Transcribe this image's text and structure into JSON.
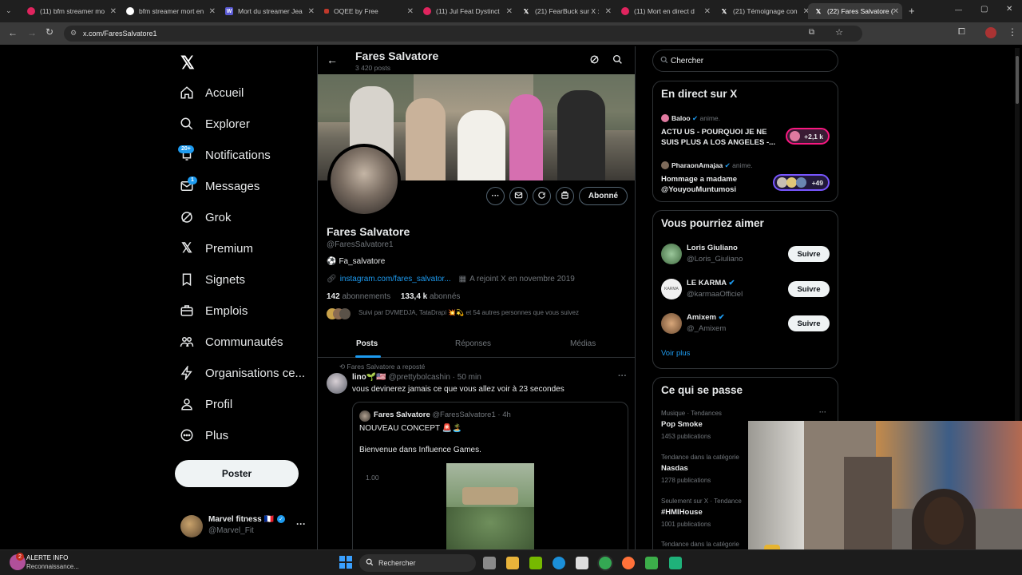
{
  "browser": {
    "tabs": [
      {
        "label": "(11) bfm streamer mo",
        "favicon": "youtube"
      },
      {
        "label": "bfm streamer mort en",
        "favicon": "google"
      },
      {
        "label": "Mort du streamer Jea",
        "favicon": "w"
      },
      {
        "label": "OQEE by Free",
        "favicon": "oqee"
      },
      {
        "label": "(11) Jul Feat Dystinct",
        "favicon": "youtube"
      },
      {
        "label": "(21) FearBuck sur X :",
        "favicon": "x"
      },
      {
        "label": "(11) Mort en direct d",
        "favicon": "youtube"
      },
      {
        "label": "(21) Témoignage con",
        "favicon": "x"
      },
      {
        "label": "(22) Fares Salvatore (",
        "favicon": "x"
      }
    ],
    "url": "x.com/FaresSalvatore1"
  },
  "nav": {
    "items": [
      {
        "label": "Accueil",
        "icon": "home-icon"
      },
      {
        "label": "Explorer",
        "icon": "search-icon"
      },
      {
        "label": "Notifications",
        "icon": "bell-icon",
        "badge": "20+"
      },
      {
        "label": "Messages",
        "icon": "mail-icon",
        "badge": "1"
      },
      {
        "label": "Grok",
        "icon": "grok-icon"
      },
      {
        "label": "Premium",
        "icon": "x-logo-icon"
      },
      {
        "label": "Signets",
        "icon": "bookmark-icon"
      },
      {
        "label": "Emplois",
        "icon": "briefcase-icon"
      },
      {
        "label": "Communautés",
        "icon": "people-icon"
      },
      {
        "label": "Organisations ce...",
        "icon": "lightning-icon"
      },
      {
        "label": "Profil",
        "icon": "person-icon"
      },
      {
        "label": "Plus",
        "icon": "more-circle-icon"
      }
    ],
    "post_button": "Poster",
    "account": {
      "name": "Marvel fitness 🇫🇷",
      "handle": "@Marvel_Fit"
    }
  },
  "profile": {
    "header_name": "Fares Salvatore",
    "header_posts": "3 420 posts",
    "name": "Fares Salvatore",
    "handle": "@FaresSalvatore1",
    "bio": "Fa_salvatore",
    "link": "instagram.com/fares_salvator...",
    "joined": "A rejoint X en novembre 2019",
    "following_count": "142",
    "following_label": "abonnements",
    "followers_count": "133,4 k",
    "followers_label": "abonnés",
    "followed_by": "Suivi par DVMEDJA, TataDrapi",
    "followed_by_more": "et 54 autres personnes que vous suivez",
    "follow_button": "Abonné",
    "tabs": [
      "Posts",
      "Réponses",
      "Médias"
    ]
  },
  "feed": {
    "repost_label": "Fares Salvatore a reposté",
    "post": {
      "author": "lino",
      "author_emoji": "🌱🇺🇸",
      "handle": "@prettybolcashin",
      "time": "· 50 min",
      "text": "vous devinerez jamais ce que vous allez voir à 23 secondes"
    },
    "quote": {
      "author": "Fares Salvatore",
      "handle": "@FaresSalvatore1",
      "time": "· 4h",
      "line1": "NOUVEAU CONCEPT 🚨🏝️",
      "line2": "Bienvenue dans Influence Games.",
      "media_label": "1.00"
    }
  },
  "right": {
    "search_placeholder": "Chercher",
    "live": {
      "title": "En direct sur X",
      "items": [
        {
          "host": "Baloo",
          "action": "anime.",
          "text": "ACTU US - POURQUOI JE NE SUIS PLUS A LOS ANGELES -...",
          "count": "+2,1 k"
        },
        {
          "host": "PharaonAmajaa",
          "action": "anime.",
          "text": "Hommage a madame @YouyouMuntumosi",
          "count": "+49"
        }
      ]
    },
    "suggest": {
      "title": "Vous pourriez aimer",
      "items": [
        {
          "name": "Loris Giuliano",
          "handle": "@Loris_Giuliano",
          "verified": false,
          "button": "Suivre"
        },
        {
          "name": "LE KARMA",
          "handle": "@karmaaOfficiel",
          "verified": true,
          "button": "Suivre"
        },
        {
          "name": "Amixem",
          "handle": "@_Amixem",
          "verified": true,
          "button": "Suivre"
        }
      ],
      "more": "Voir plus"
    },
    "trends": {
      "title": "Ce qui se passe",
      "items": [
        {
          "context": "Musique · Tendances",
          "name": "Pop Smoke",
          "count": "1453 publications"
        },
        {
          "context": "Tendance dans la catégorie",
          "name": "Nasdas",
          "count": "1278 publications"
        },
        {
          "context": "Seulement sur X · Tendance",
          "name": "#HMIHouse",
          "count": "1001 publications"
        },
        {
          "context": "Tendance dans la catégorie",
          "name": "",
          "count": ""
        }
      ]
    }
  },
  "taskbar": {
    "alert_title": "ALERTE INFO",
    "alert_sub": "Reconnaissance...",
    "alert_badge": "2",
    "search_label": "Rechercher"
  },
  "colors": {
    "accent": "#1d9bf0",
    "background": "#000000",
    "border": "#2f3336",
    "muted": "#71767b"
  }
}
